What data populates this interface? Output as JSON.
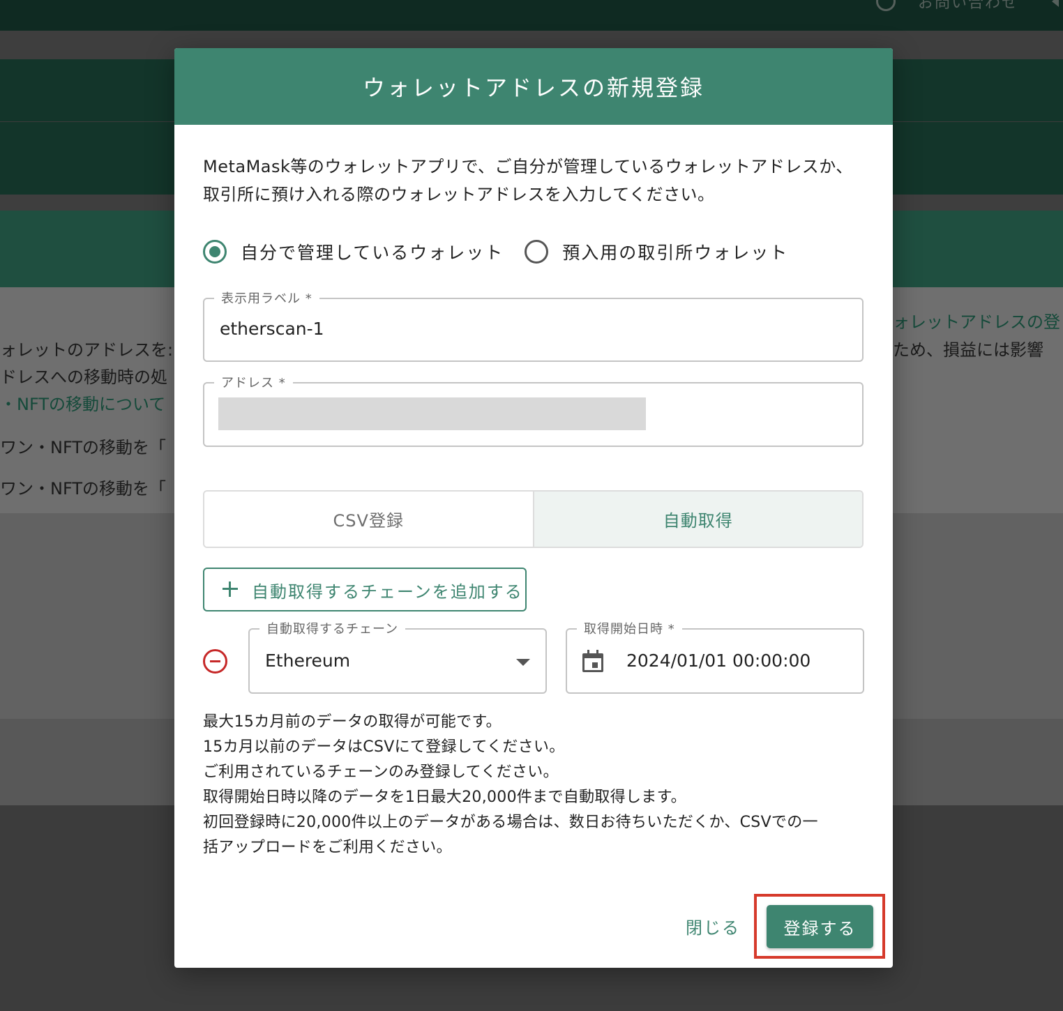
{
  "background": {
    "contact_label": "お問い合わせ",
    "left_lines": [
      "ォレットのアドレスを:",
      "ドレスへの移動時の処",
      "・NFTの移動について",
      "ワン・NFTの移動を「",
      "ワン・NFTの移動を「"
    ],
    "right_lines": [
      "ォレットアドレスの登",
      "ため、損益には影響"
    ]
  },
  "dialog": {
    "title": "ウォレットアドレスの新規登録",
    "description": "MetaMask等のウォレットアプリで、ご自分が管理しているウォレットアドレスか、取引所に預け入れる際のウォレットアドレスを入力してください。",
    "radio_options": [
      {
        "label": "自分で管理しているウォレット",
        "checked": true
      },
      {
        "label": "預入用の取引所ウォレット",
        "checked": false
      }
    ],
    "label_field": {
      "legend": "表示用ラベル *",
      "value": "etherscan-1"
    },
    "address_field": {
      "legend": "アドレス *"
    },
    "tabs": [
      {
        "label": "CSV登録",
        "active": false
      },
      {
        "label": "自動取得",
        "active": true
      }
    ],
    "add_chain_button": "自動取得するチェーンを追加する",
    "chain_field": {
      "legend": "自動取得するチェーン",
      "value": "Ethereum"
    },
    "date_field": {
      "legend": "取得開始日時 *",
      "value": "2024/01/01 00:00:00"
    },
    "notes": [
      "最大15カ月前のデータの取得が可能です。",
      "15カ月以前のデータはCSVにて登録してください。",
      "ご利用されているチェーンのみ登録してください。",
      "取得開始日時以降のデータを1日最大20,000件まで自動取得します。",
      "初回登録時に20,000件以上のデータがある場合は、数日お待ちいただくか、CSVでの一",
      "括アップロードをご利用ください。"
    ],
    "close_button": "閉じる",
    "register_button": "登録する"
  },
  "colors": {
    "accent": "#3e8570",
    "highlight": "#d63a2b",
    "remove": "#c62828"
  }
}
